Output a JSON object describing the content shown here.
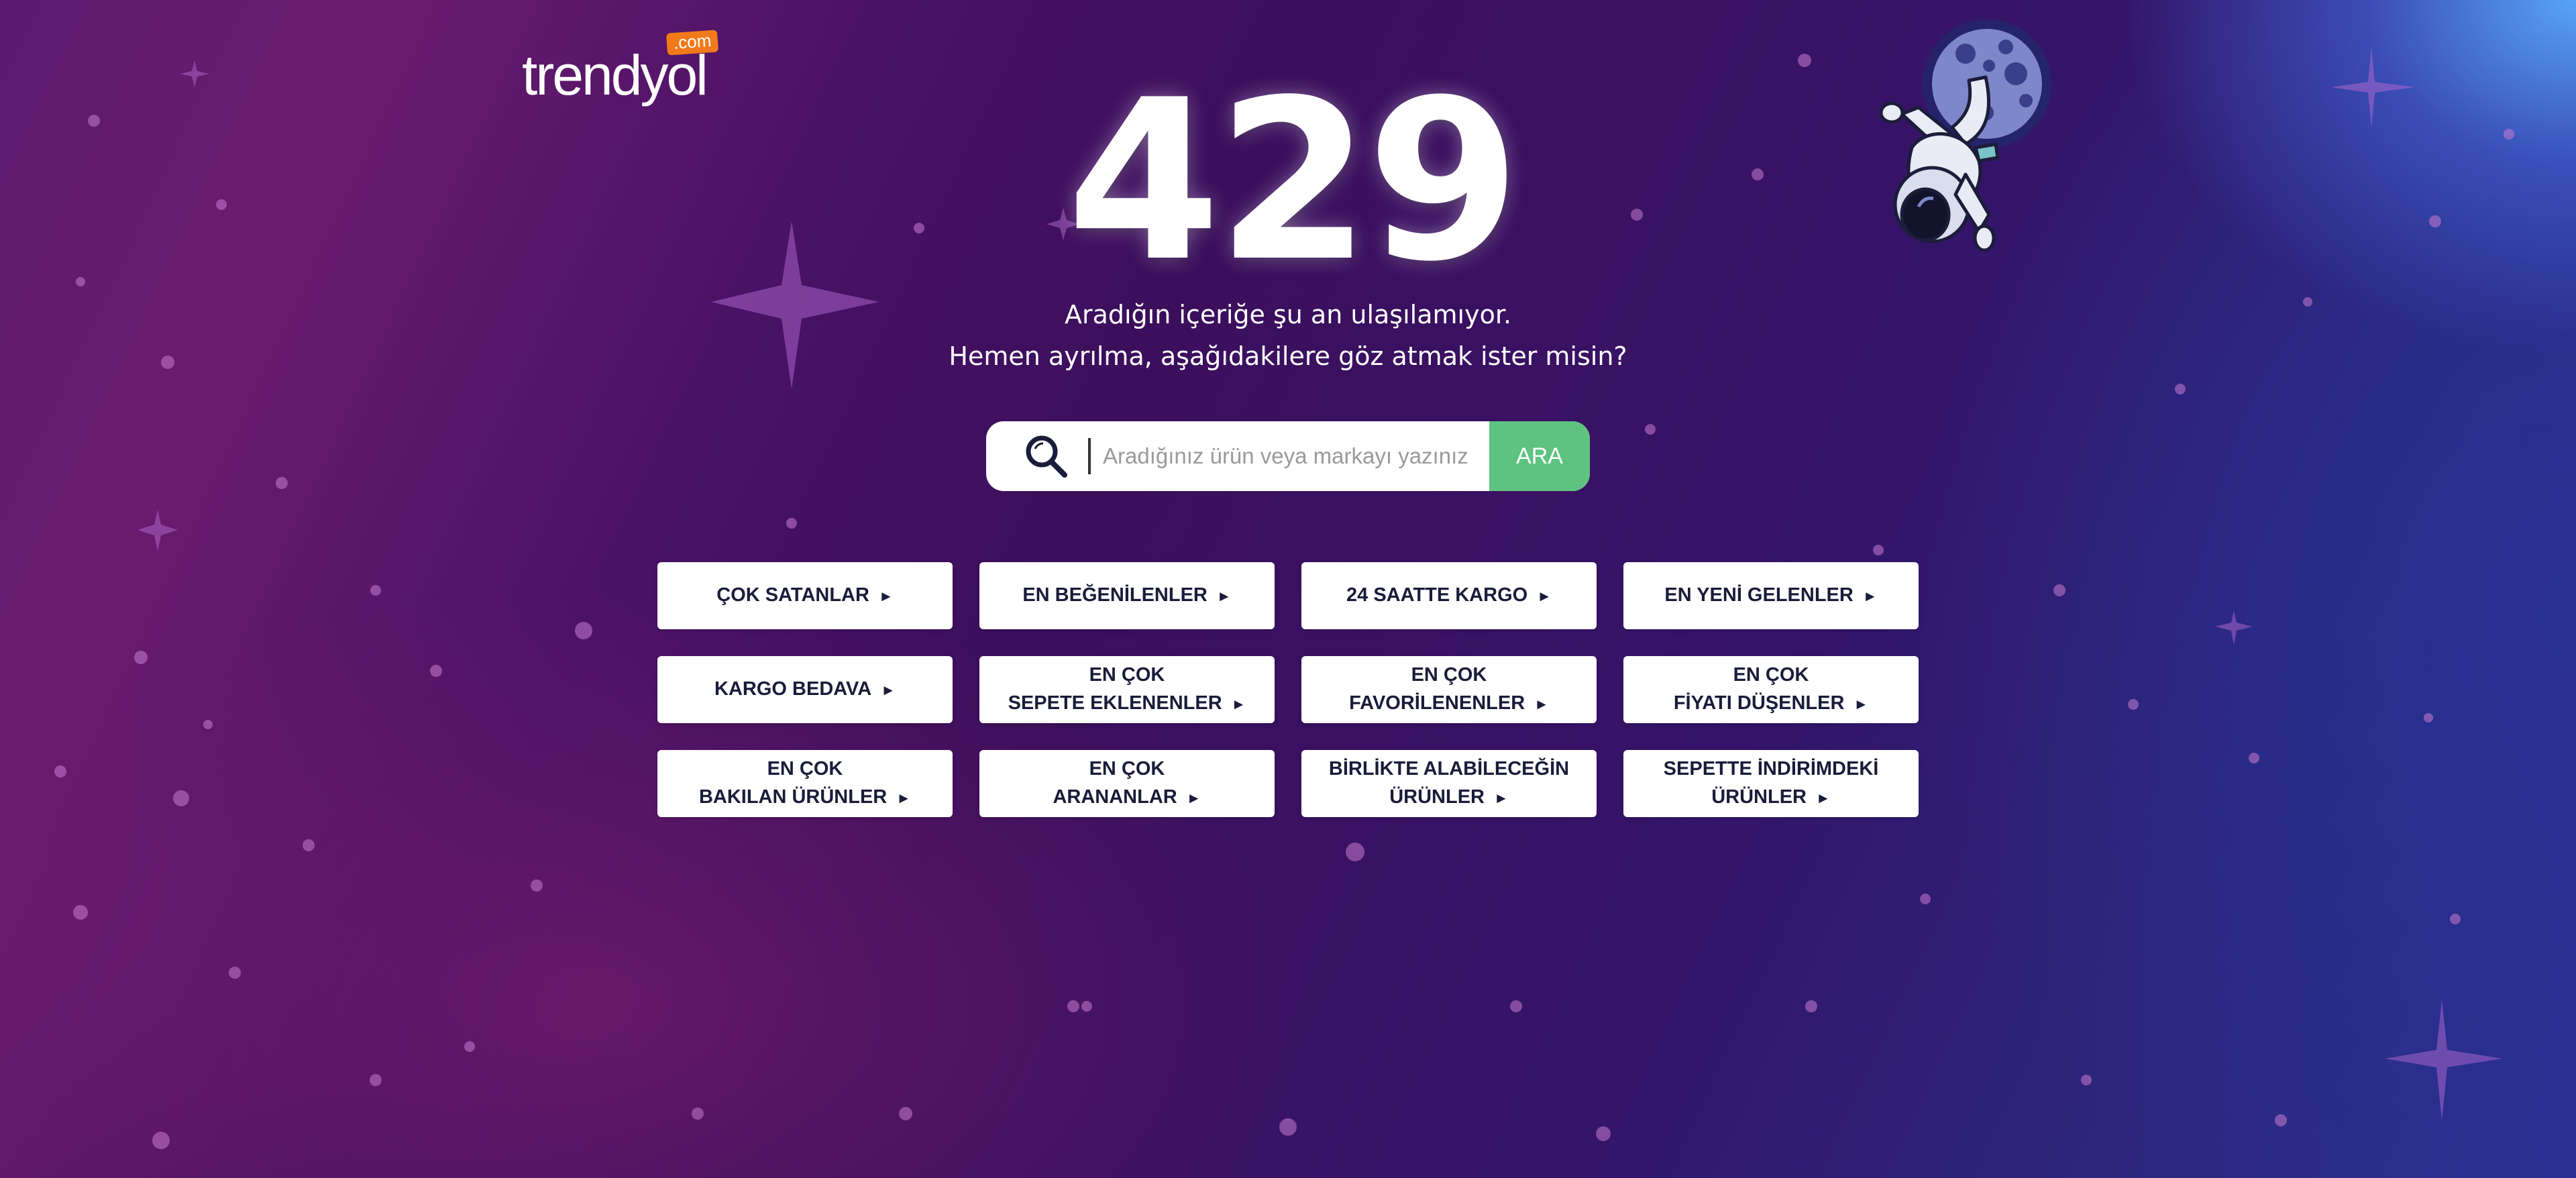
{
  "logo": {
    "text": "trendyol",
    "suffix": ".com"
  },
  "error": {
    "code": "429",
    "line1": "Aradığın içeriğe şu an ulaşılamıyor.",
    "line2": "Hemen ayrılma, aşağıdakilere göz atmak ister misin?"
  },
  "search": {
    "placeholder": "Aradığınız ürün veya markayı yazınız",
    "value": "",
    "button_label": "ARA",
    "icon": "search-icon"
  },
  "categories": [
    {
      "line1": "ÇOK SATANLAR",
      "line2": ""
    },
    {
      "line1": "EN BEĞENİLENLER",
      "line2": ""
    },
    {
      "line1": "24 SAATTE KARGO",
      "line2": ""
    },
    {
      "line1": "EN YENİ GELENLER",
      "line2": ""
    },
    {
      "line1": "KARGO BEDAVA",
      "line2": ""
    },
    {
      "line1": "EN ÇOK",
      "line2": "SEPETE EKLENENLER"
    },
    {
      "line1": "EN ÇOK",
      "line2": "FAVORİLENENLER"
    },
    {
      "line1": "EN ÇOK",
      "line2": "FİYATI DÜŞENLER"
    },
    {
      "line1": "EN ÇOK",
      "line2": "BAKILAN ÜRÜNLER"
    },
    {
      "line1": "EN ÇOK",
      "line2": "ARANANLAR"
    },
    {
      "line1": "BİRLİKTE ALABİLECEĞİN",
      "line2": "ÜRÜNLER"
    },
    {
      "line1": "SEPETTE İNDİRİMDEKİ",
      "line2": "ÜRÜNLER"
    }
  ],
  "arrow_glyph": "►",
  "colors": {
    "accent_green": "#5ec37f",
    "brand_orange": "#f27a1a",
    "text_dark": "#1b1b3a"
  }
}
